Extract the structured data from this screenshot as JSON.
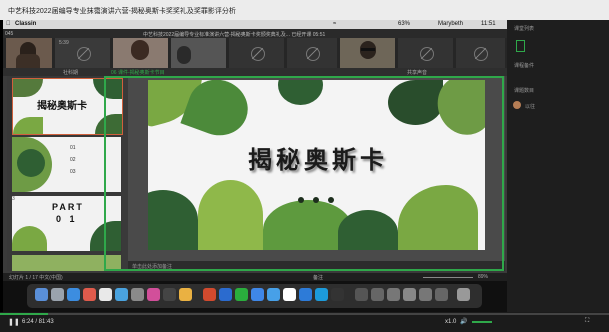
{
  "outer": {
    "title": "中艺科技2022届编导专业抹霭演讲六营-揭秘奥斯卡奖奖礼及奖罪影评分析"
  },
  "menubar": {
    "app": "Classin",
    "battery": "63%",
    "user": "Marybeth",
    "clock": "11:51"
  },
  "classin_bar": {
    "left_code": "045",
    "title": "中艺科技2022届编导专业标准演讲六营-揭秘奥斯卡奖颁奖典礼及...  已经开课 05:51",
    "tile_label": "5:39"
  },
  "ppt": {
    "left_label": "社科期",
    "file_title": "06 课件-揭秘奥斯卡节目",
    "right_label": "共享声音",
    "slide_title": "揭秘奥斯卡",
    "notes_placeholder": "单击此处添加备注",
    "status_left": "幻灯片 1 / 17   中文(中国)",
    "status_notes": "备注",
    "status_zoom": "89%"
  },
  "thumbnails": [
    {
      "num": "1",
      "title": "揭秘奥斯卡"
    },
    {
      "num": "2",
      "rows": [
        "01",
        "02",
        "03"
      ]
    },
    {
      "num": "3",
      "text": "PART",
      "sub": "0 1"
    },
    {
      "num": "4",
      "text": ""
    }
  ],
  "right_panel": {
    "item1": "课堂列表",
    "item2": "课程备件",
    "item3": "课题数目",
    "user": "以往"
  },
  "player": {
    "time": "6:24 / 81:43",
    "speed": "x1.0"
  },
  "progress_fraction": 0.078,
  "colors": {
    "accent": "#2fa84a",
    "leaf_dark": "#2f5f33",
    "leaf_light": "#7aa843"
  }
}
